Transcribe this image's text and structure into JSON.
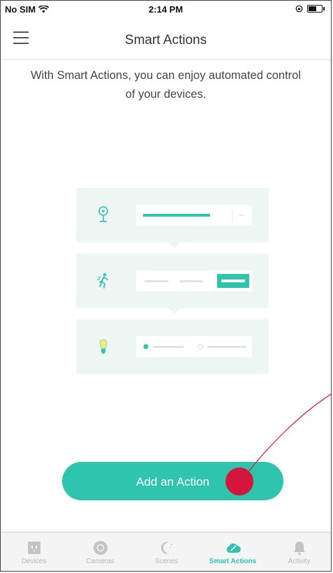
{
  "status_bar": {
    "carrier": "No SIM",
    "time": "2:14 PM",
    "battery_level": 0.7
  },
  "nav": {
    "title": "Smart Actions"
  },
  "intro_text": "With Smart Actions, you can enjoy automated control of your devices.",
  "illustration": {
    "cards": [
      {
        "icon": "camera-icon"
      },
      {
        "icon": "motion-icon"
      },
      {
        "icon": "bulb-icon"
      }
    ]
  },
  "add_action_label": "Add an Action",
  "tabs": [
    {
      "label": "Devices",
      "icon": "plug-icon",
      "active": false
    },
    {
      "label": "Cameras",
      "icon": "camera-lens-icon",
      "active": false
    },
    {
      "label": "Scenes",
      "icon": "moon-icon",
      "active": false
    },
    {
      "label": "Smart Actions",
      "icon": "cloud-wand-icon",
      "active": true
    },
    {
      "label": "Activity",
      "icon": "bell-icon",
      "active": false
    }
  ],
  "colors": {
    "accent": "#2ec4ad",
    "touch_indicator": "#d4163c"
  }
}
